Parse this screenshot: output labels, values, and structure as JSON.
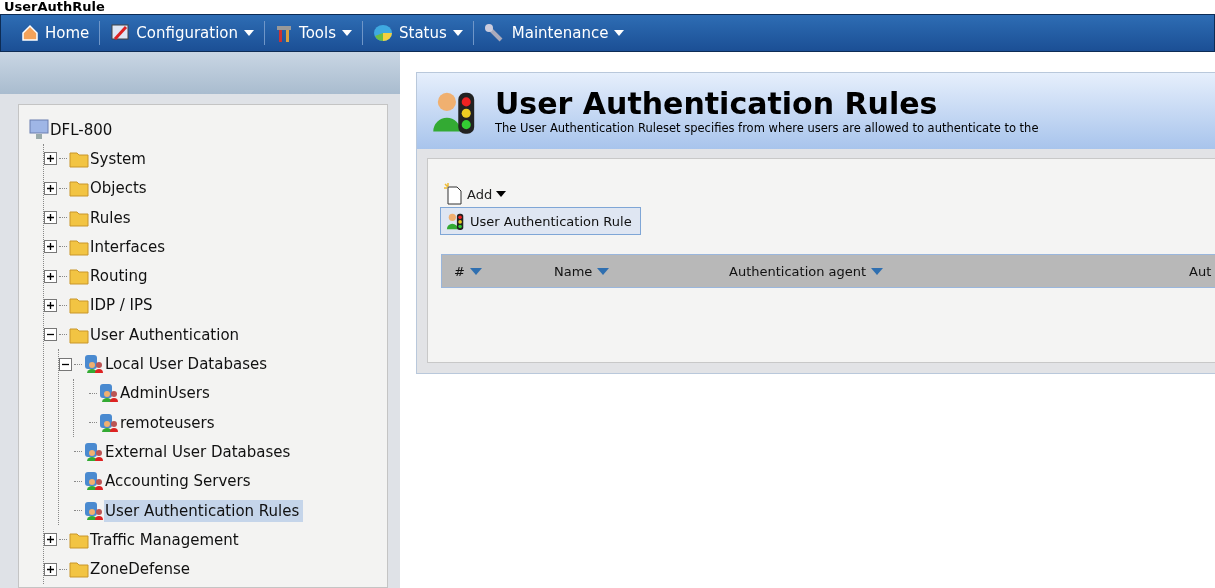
{
  "page_heading": "UserAuthRule",
  "nav": [
    {
      "label": "Home",
      "dropdown": false
    },
    {
      "label": "Configuration",
      "dropdown": true
    },
    {
      "label": "Tools",
      "dropdown": true
    },
    {
      "label": "Status",
      "dropdown": true
    },
    {
      "label": "Maintenance",
      "dropdown": true
    }
  ],
  "tree": {
    "label": "DFL-800",
    "selected": false,
    "children": [
      {
        "label": "System",
        "expanded": false,
        "selected": false
      },
      {
        "label": "Objects",
        "expanded": false,
        "selected": false
      },
      {
        "label": "Rules",
        "expanded": false,
        "selected": false
      },
      {
        "label": "Interfaces",
        "expanded": false,
        "selected": false
      },
      {
        "label": "Routing",
        "expanded": false,
        "selected": false
      },
      {
        "label": "IDP / IPS",
        "expanded": false,
        "selected": false
      },
      {
        "label": "User Authentication",
        "expanded": true,
        "selected": false,
        "children": [
          {
            "label": "Local User Databases",
            "expanded": true,
            "selected": false,
            "children": [
              {
                "label": "AdminUsers",
                "selected": false
              },
              {
                "label": "remoteusers",
                "selected": false
              }
            ]
          },
          {
            "label": "External User Databases",
            "selected": false
          },
          {
            "label": "Accounting Servers",
            "selected": false
          },
          {
            "label": "User Authentication Rules",
            "selected": true
          }
        ]
      },
      {
        "label": "Traffic Management",
        "expanded": false,
        "selected": false
      },
      {
        "label": "ZoneDefense",
        "expanded": false,
        "selected": false
      }
    ]
  },
  "content": {
    "title": "User Authentication Rules",
    "description": "The User Authentication Ruleset specifies from where users are allowed to authenticate to the",
    "add_button": "Add",
    "add_menu": [
      {
        "label": "User Authentication Rule",
        "selected": true
      }
    ],
    "columns": [
      {
        "label": "#",
        "sortable": true
      },
      {
        "label": "Name",
        "sortable": true
      },
      {
        "label": "Authentication agent",
        "sortable": true
      },
      {
        "label": "Aut",
        "sortable": false
      }
    ]
  }
}
